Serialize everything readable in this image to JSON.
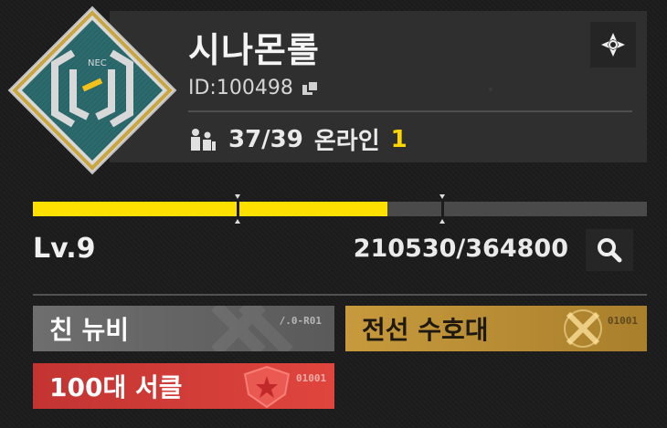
{
  "guild": {
    "name": "시나몬롤",
    "id_label": "ID:",
    "id_value": "100498",
    "member_count": "37/39",
    "online_label": "온라인",
    "online_count": "1",
    "emblem_text": "NEC"
  },
  "progress": {
    "level": "Lv.9",
    "xp_text": "210530/364800",
    "xp_current": 210530,
    "xp_max": 364800,
    "segment_fill_fraction": 0.578
  },
  "badges": [
    {
      "label": "친 뉴비",
      "code": "/.0-R01",
      "color": "#6a6a6a"
    },
    {
      "label": "전선 수호대",
      "code": "01001",
      "color": "#c59a3a"
    },
    {
      "label": "100대 서클",
      "code": "01001",
      "color": "#d23b36"
    }
  ],
  "colors": {
    "accent_yellow": "#ffe100",
    "panel_bg": "#2f2f2f",
    "bg": "#1c1c1c"
  },
  "icons": {
    "settings": "compass-settings-icon",
    "copy": "copy-icon",
    "members": "members-icon",
    "search": "search-icon"
  }
}
